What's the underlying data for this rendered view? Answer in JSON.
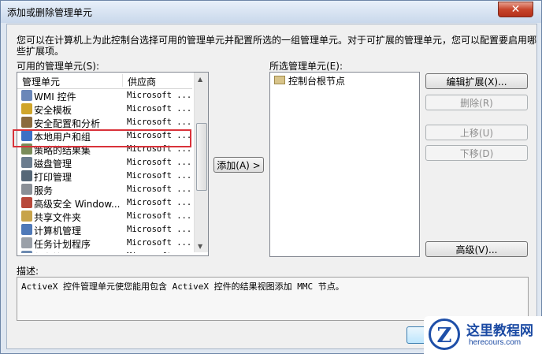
{
  "window": {
    "title": "添加或删除管理单元",
    "close_glyph": "✕"
  },
  "intro_text": "您可以在计算机上为此控制台选择可用的管理单元并配置所选的一组管理单元。对于可扩展的管理单元，您可以配置要启用哪些扩展项。",
  "available": {
    "label": "可用的管理单元(S):",
    "col_name": "管理单元",
    "col_vendor": "供应商",
    "rows": [
      {
        "name": "WMI 控件",
        "vendor": "Microsoft ...",
        "icon": "wmi-icon"
      },
      {
        "name": "安全模板",
        "vendor": "Microsoft ...",
        "icon": "security-template-icon"
      },
      {
        "name": "安全配置和分析",
        "vendor": "Microsoft ...",
        "icon": "security-analysis-icon"
      },
      {
        "name": "本地用户和组",
        "vendor": "Microsoft ...",
        "icon": "users-groups-icon"
      },
      {
        "name": "策略的结果集",
        "vendor": "Microsoft ...",
        "icon": "policy-icon"
      },
      {
        "name": "磁盘管理",
        "vendor": "Microsoft ...",
        "icon": "disk-icon"
      },
      {
        "name": "打印管理",
        "vendor": "Microsoft ...",
        "icon": "printer-icon"
      },
      {
        "name": "服务",
        "vendor": "Microsoft ...",
        "icon": "services-icon"
      },
      {
        "name": "高级安全 Window...",
        "vendor": "Microsoft ...",
        "icon": "firewall-icon"
      },
      {
        "name": "共享文件夹",
        "vendor": "Microsoft ...",
        "icon": "shared-folder-icon"
      },
      {
        "name": "计算机管理",
        "vendor": "Microsoft ...",
        "icon": "computer-icon"
      },
      {
        "name": "任务计划程序",
        "vendor": "Microsoft ...",
        "icon": "clock-icon"
      },
      {
        "name": "任务管理器",
        "vendor": "Microsoft ...",
        "icon": "task-icon"
      }
    ]
  },
  "add_button": "添加(A) >",
  "selected": {
    "label": "所选管理单元(E):",
    "root": "控制台根节点"
  },
  "buttons": {
    "edit_ext": "编辑扩展(X)...",
    "remove": "删除(R)",
    "move_up": "上移(U)",
    "move_down": "下移(D)",
    "advanced": "高级(V)..."
  },
  "description": {
    "label": "描述:",
    "text": "ActiveX 控件管理单元使您能用包含 ActiveX 控件的结果视图添加 MMC 节点。"
  },
  "ok_button": "确",
  "watermark": {
    "letter": "Z",
    "name": "这里教程网",
    "url": "herecours.com"
  }
}
